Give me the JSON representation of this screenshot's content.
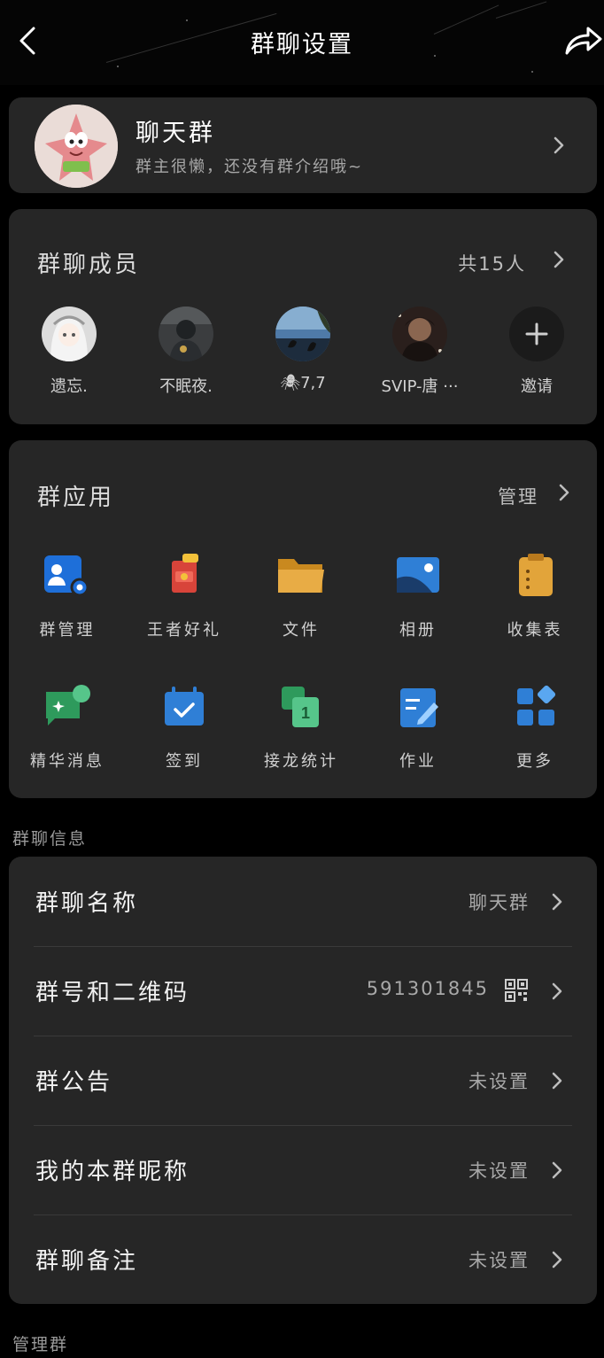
{
  "header": {
    "title": "群聊设置"
  },
  "group": {
    "name": "聊天群",
    "description": "群主很懒，还没有群介绍哦~"
  },
  "members": {
    "title": "群聊成员",
    "count_text": "共15人",
    "list": [
      {
        "name": "遗忘."
      },
      {
        "name": "不眠夜."
      },
      {
        "name": "🕷7,7"
      },
      {
        "name": "SVIP-唐 ···"
      }
    ],
    "invite_label": "邀请"
  },
  "apps": {
    "title": "群应用",
    "manage_label": "管理",
    "items": [
      {
        "label": "群管理",
        "icon": "group-manage-icon"
      },
      {
        "label": "王者好礼",
        "icon": "gift-icon"
      },
      {
        "label": "文件",
        "icon": "folder-icon"
      },
      {
        "label": "相册",
        "icon": "album-icon"
      },
      {
        "label": "收集表",
        "icon": "clipboard-icon"
      },
      {
        "label": "精华消息",
        "icon": "essence-message-icon"
      },
      {
        "label": "签到",
        "icon": "checkin-calendar-icon"
      },
      {
        "label": "接龙统计",
        "icon": "relay-count-icon"
      },
      {
        "label": "作业",
        "icon": "homework-icon"
      },
      {
        "label": "更多",
        "icon": "more-apps-icon"
      }
    ]
  },
  "info": {
    "section_label": "群聊信息",
    "rows": [
      {
        "label": "群聊名称",
        "value": "聊天群"
      },
      {
        "label": "群号和二维码",
        "value": "591301845"
      },
      {
        "label": "群公告",
        "value": "未设置"
      },
      {
        "label": "我的本群昵称",
        "value": "未设置"
      },
      {
        "label": "群聊备注",
        "value": "未设置"
      }
    ]
  },
  "manage": {
    "section_label": "管理群"
  },
  "colors": {
    "background": "#000000",
    "card": "#262626",
    "accent_blue": "#1e6fd9",
    "accent_green": "#2e9a5c",
    "accent_orange": "#e2a43a"
  }
}
